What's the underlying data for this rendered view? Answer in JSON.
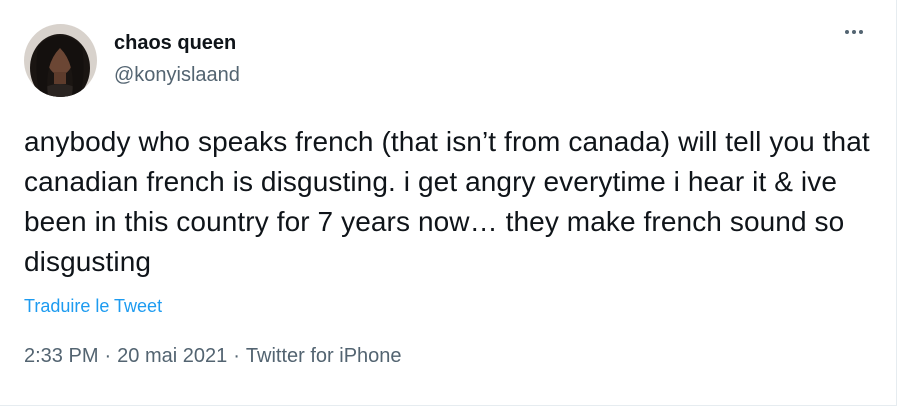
{
  "tweet": {
    "display_name": "chaos queen",
    "handle": "@konyislaand",
    "text": "anybody who speaks french (that isn’t from canada) will tell you that canadian french is disgusting. i get angry everytime i hear it & ive been in this country for 7 years now… they make french sound so disgusting",
    "translate_label": "Traduire le Tweet",
    "time": "2:33 PM",
    "date": "20 mai 2021",
    "source": "Twitter for iPhone",
    "separator": "·"
  },
  "icons": {
    "more": "more-horizontal-icon",
    "avatar": "profile-photo"
  },
  "colors": {
    "text": "#0f1419",
    "secondary": "#536471",
    "link": "#1d9bf0"
  }
}
